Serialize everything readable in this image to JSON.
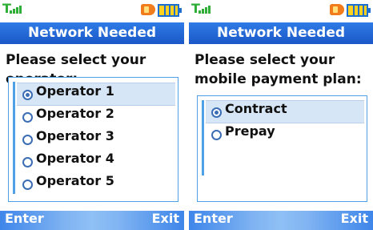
{
  "colors": {
    "title_bar": "#1b57c8",
    "status_green": "#2fae35",
    "selection": "#d7e6f6",
    "softkey_bar": "#3f86ea"
  },
  "status_icons": [
    "signal-icon",
    "speaker-icon",
    "battery-icon"
  ],
  "screens": [
    {
      "title": "Network Needed",
      "prompt": "Please select your operator:",
      "options": [
        {
          "label": "Operator 1",
          "selected": true
        },
        {
          "label": "Operator 2",
          "selected": false
        },
        {
          "label": "Operator 3",
          "selected": false
        },
        {
          "label": "Operator 4",
          "selected": false
        },
        {
          "label": "Operator 5",
          "selected": false
        }
      ],
      "softkeys": {
        "left": "Enter",
        "right": "Exit"
      }
    },
    {
      "title": "Network Needed",
      "prompt": "Please select your mobile payment plan:",
      "options": [
        {
          "label": "Contract",
          "selected": true
        },
        {
          "label": "Prepay",
          "selected": false
        }
      ],
      "softkeys": {
        "left": "Enter",
        "right": "Exit"
      }
    }
  ]
}
